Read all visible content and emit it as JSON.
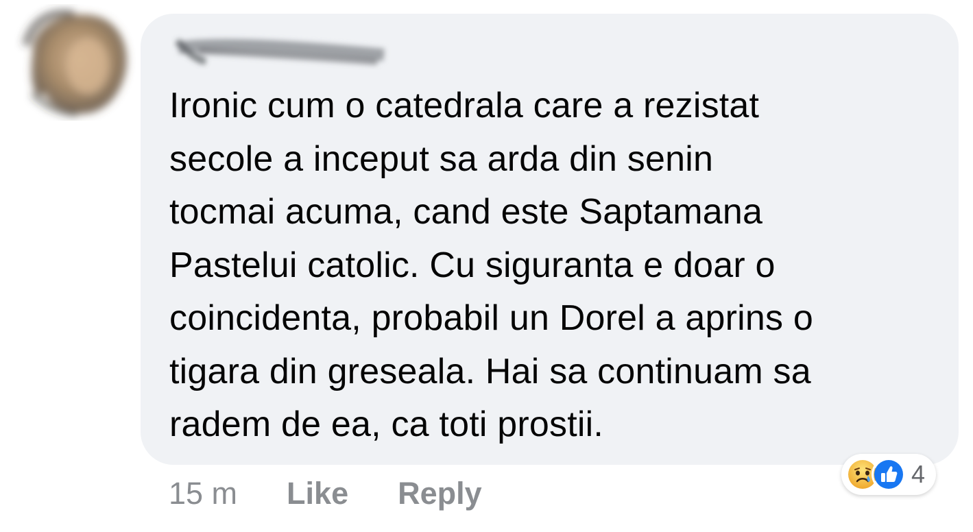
{
  "comment": {
    "text_lines": [
      "Ironic cum o catedrala care a rezistat",
      "secole a inceput sa arda din senin",
      "tocmai acuma, cand este Saptamana",
      "Pastelui catolic. Cu siguranta e doar o",
      "coincidenta, probabil un Dorel a aprins o",
      "tigara din greseala. Hai sa continuam sa",
      "radem de ea, ca toti prostii."
    ],
    "timestamp": "15 m",
    "like_label": "Like",
    "reply_label": "Reply",
    "reactions": {
      "icons": [
        "sad-reaction-icon",
        "like-reaction-icon"
      ],
      "count": "4"
    }
  },
  "colors": {
    "bubble_bg": "#f0f2f5",
    "text": "#050505",
    "meta_text": "#8a8d91",
    "like_blue": "#1877f2",
    "sad_yellow": "#f7c33c"
  }
}
